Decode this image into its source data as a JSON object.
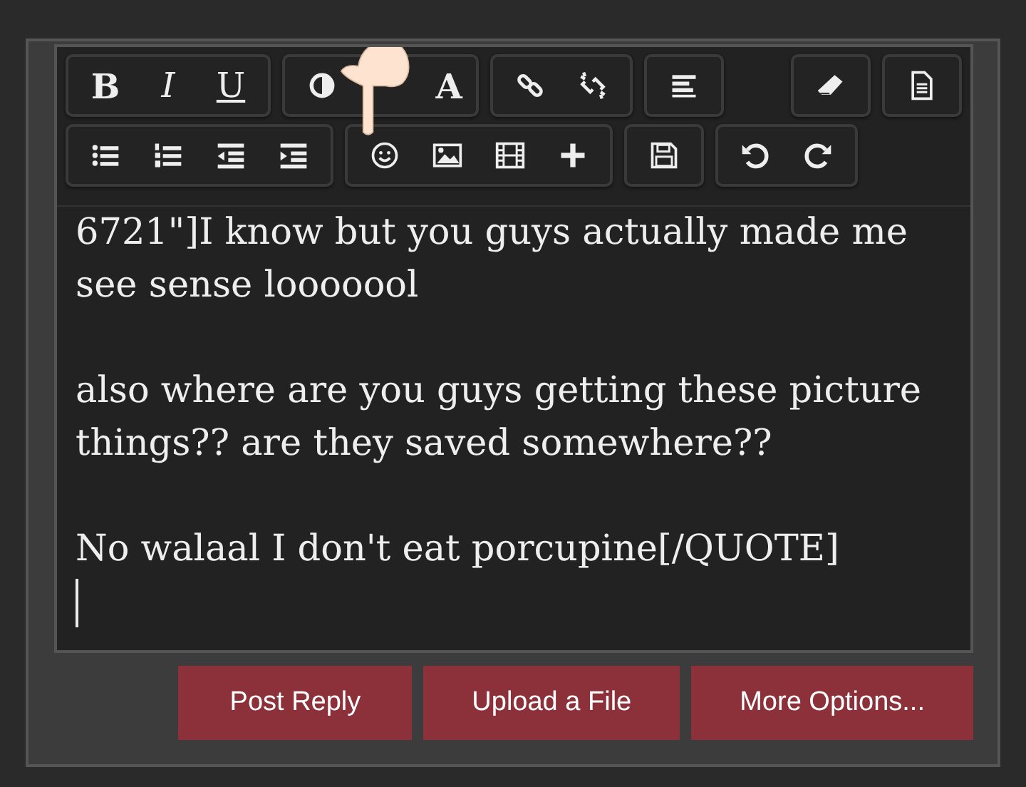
{
  "toolbar": {
    "rows": [
      [
        {
          "buttons": [
            {
              "kind": "bold",
              "label": "B"
            },
            {
              "kind": "italic",
              "label": "I"
            },
            {
              "kind": "underline",
              "label": "U"
            }
          ]
        },
        {
          "buttons": [
            {
              "kind": "contrast"
            },
            {
              "kind": "blank"
            },
            {
              "kind": "letter",
              "label": "A"
            }
          ]
        },
        {
          "buttons": [
            {
              "kind": "link"
            },
            {
              "kind": "unlink"
            }
          ]
        },
        {
          "buttons": [
            {
              "kind": "align"
            }
          ]
        },
        {
          "kind": "spacer"
        },
        {
          "buttons": [
            {
              "kind": "eraser"
            }
          ]
        },
        {
          "buttons": [
            {
              "kind": "document"
            }
          ]
        }
      ],
      [
        {
          "buttons": [
            {
              "kind": "bullets"
            },
            {
              "kind": "numbers"
            },
            {
              "kind": "outdent"
            },
            {
              "kind": "indent"
            }
          ]
        },
        {
          "buttons": [
            {
              "kind": "smiley"
            },
            {
              "kind": "image"
            },
            {
              "kind": "film"
            },
            {
              "kind": "plus"
            }
          ]
        },
        {
          "buttons": [
            {
              "kind": "save"
            }
          ]
        },
        {
          "buttons": [
            {
              "kind": "undo"
            },
            {
              "kind": "redo"
            }
          ]
        }
      ]
    ]
  },
  "editor": {
    "paragraphs": [
      {
        "lines": [
          "6721\"]I know but you guys actually made me",
          "see sense looooool"
        ]
      },
      {
        "lines": [
          "also where are you guys getting these picture",
          "things?? are they saved somewhere??"
        ]
      },
      {
        "lines": [
          "No walaal I don't eat porcupine[/QUOTE]"
        ]
      }
    ],
    "cursor": true
  },
  "actions": [
    "Post Reply",
    "Upload a File",
    "More Options..."
  ]
}
